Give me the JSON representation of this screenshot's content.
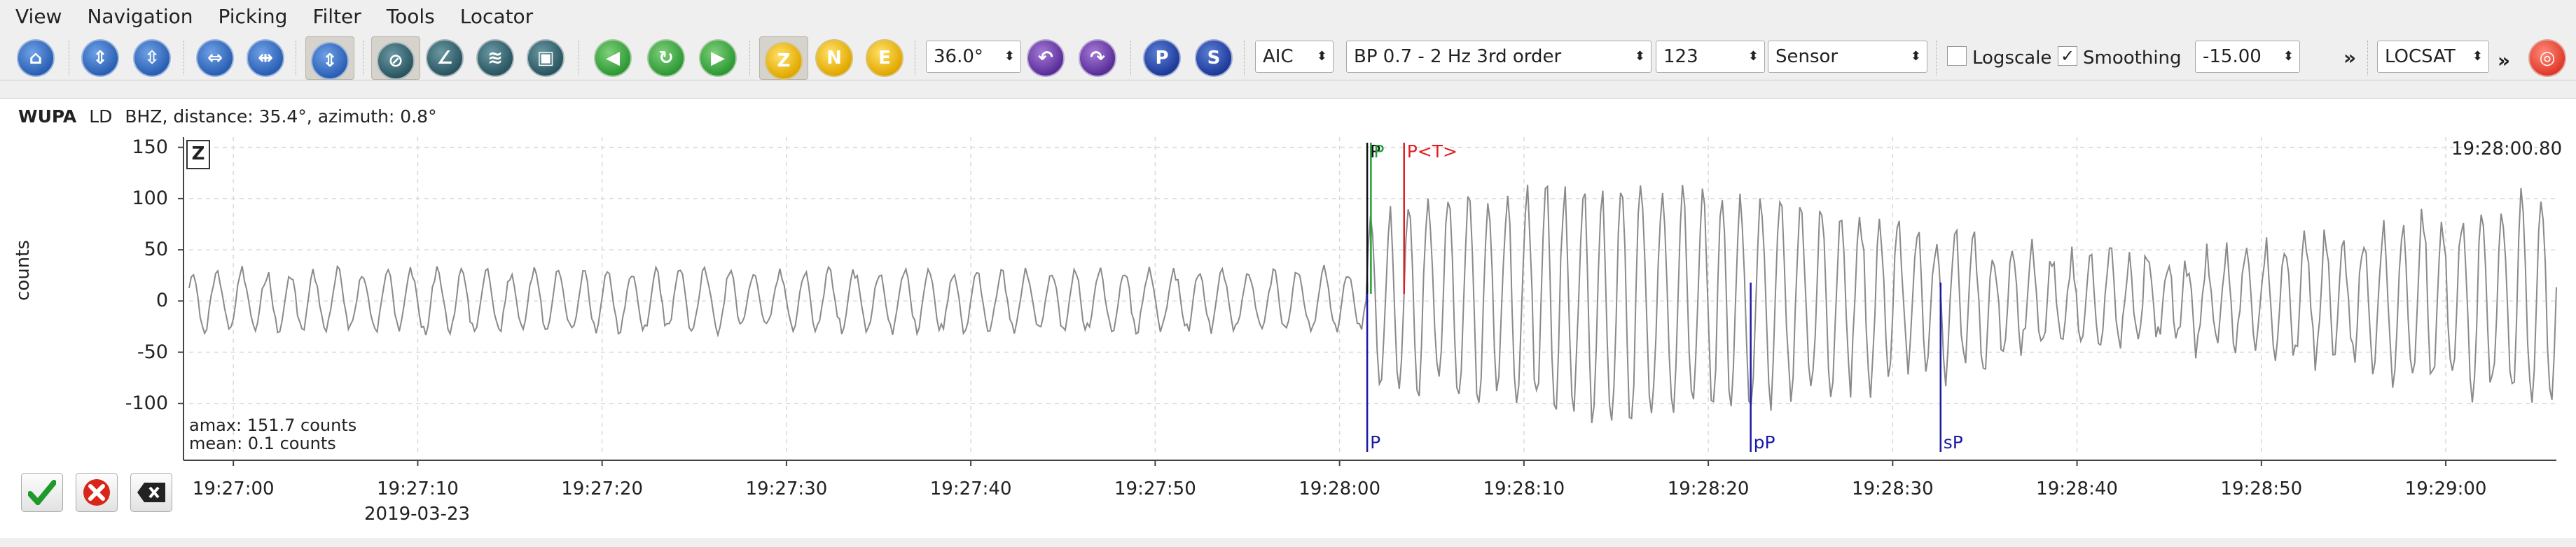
{
  "menu": [
    "View",
    "Navigation",
    "Picking",
    "Filter",
    "Tools",
    "Locator"
  ],
  "toolbar": {
    "zoom_value": "36.0°",
    "picker_method": "AIC",
    "filter": "BP 0.7 - 2 Hz  3rd order",
    "filter_id": "123",
    "unit_mode": "Sensor",
    "logscale_label": "Logscale",
    "logscale_checked": false,
    "smoothing_label": "Smoothing",
    "smoothing_checked": true,
    "smoothing_value": "-15.00",
    "locator": "LOCSAT",
    "overflow": "»",
    "components": [
      "Z",
      "N",
      "E"
    ],
    "phase_buttons": [
      "P",
      "S"
    ]
  },
  "trace": {
    "station": "WUPA",
    "network": "LD",
    "channel": "BHZ",
    "info": "distance: 35.4°, azimuth: 0.8°",
    "component_label": "Z",
    "timestamp": "19:28:00.80",
    "ylabel": "counts",
    "amax": "amax: 151.7 counts",
    "mean": "mean: 0.1 counts",
    "date": "2019-03-23"
  },
  "picks": [
    {
      "label": "P",
      "color": "#1a1aa8",
      "time": "19:28:01.5",
      "where": "bottom"
    },
    {
      "label": "P",
      "color": "#111111",
      "time": "19:28:01.5",
      "where": "top"
    },
    {
      "label": "P",
      "color": "#21a03a",
      "time": "19:28:01.7",
      "where": "top"
    },
    {
      "label": "P<T>",
      "color": "#e02020",
      "time": "19:28:03.5",
      "where": "top"
    },
    {
      "label": "pP",
      "color": "#1a1aa8",
      "time": "19:28:22.3",
      "where": "bottom"
    },
    {
      "label": "sP",
      "color": "#1a1aa8",
      "time": "19:28:32.6",
      "where": "bottom"
    }
  ],
  "chart_data": {
    "type": "line",
    "ylabel": "counts",
    "ylim": [
      -150,
      160
    ],
    "yticks": [
      150,
      100,
      50,
      0,
      -50,
      -100
    ],
    "xticks": [
      "19:27:00",
      "19:27:10",
      "19:27:20",
      "19:27:30",
      "19:27:40",
      "19:27:50",
      "19:28:00",
      "19:28:10",
      "19:28:20",
      "19:28:30",
      "19:28:40",
      "19:28:50",
      "19:29:00"
    ],
    "grid": true
  },
  "colors": {
    "trace": "#8a8a8a",
    "pick_blue": "#1a1aa8",
    "pick_red": "#e02020",
    "pick_green": "#21a03a"
  }
}
